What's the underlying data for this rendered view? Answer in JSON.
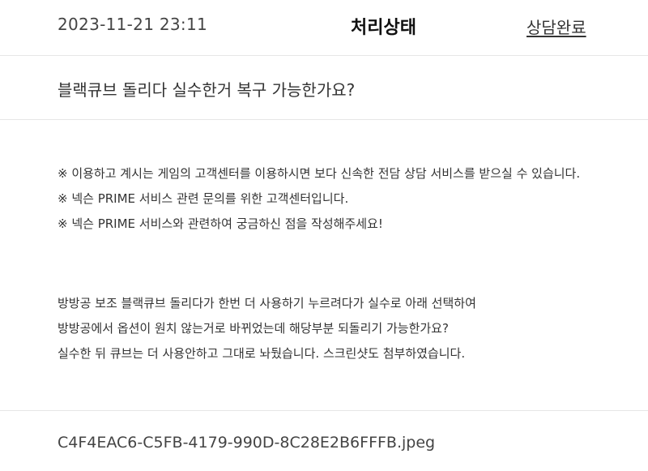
{
  "header": {
    "datetime": "2023-11-21 23:11",
    "status_title": "처리상태",
    "status_value": "상담완료"
  },
  "subject": "블랙큐브 돌리다 실수한거 복구 가능한가요?",
  "notice_lines": [
    "※ 이용하고 계시는 게임의 고객센터를 이용하시면 보다 신속한 전담 상담 서비스를 받으실 수 있습니다.",
    "※ 넥슨 PRIME 서비스 관련 문의를 위한 고객센터입니다.",
    "※ 넥슨 PRIME 서비스와 관련하여 궁금하신 점을 작성해주세요!"
  ],
  "body_lines": [
    "방방공 보조 블랙큐브 돌리다가 한번 더 사용하기 누르려다가 실수로 아래 선택하여",
    "방방공에서 옵션이 원치 않는거로 바뀌었는데 해당부분 되돌리기 가능한가요?",
    "실수한 뒤 큐브는 더 사용안하고 그대로 놔뒀습니다. 스크린샷도 첨부하였습니다."
  ],
  "attachment": {
    "filename": "C4F4EAC6-C5FB-4179-990D-8C28E2B6FFFB.jpeg"
  }
}
